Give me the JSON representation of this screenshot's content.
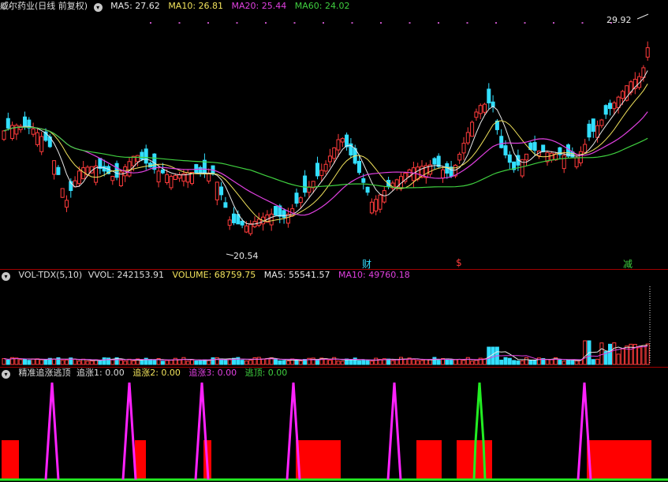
{
  "colors": {
    "up": "#ff3b3b",
    "down": "#33dfff",
    "ma5": "#e8e8e8",
    "ma10": "#f2e35c",
    "ma20": "#e040e0",
    "ma60": "#3fcf3f",
    "volume": "#e8e8e8",
    "signal_main": "#ff22ff",
    "signal_green": "#22ee22",
    "signal_block": "#ff0000"
  },
  "main_panel": {
    "stock_name": "威尔药业(日线 前复权)",
    "collapse_icon": "chevron-down-icon",
    "ma5": "MA5: 27.62",
    "ma10": "MA10: 26.81",
    "ma20": "MA20: 25.44",
    "ma60": "MA60: 24.02",
    "high_label": "29.92",
    "low_label": "20.54",
    "events": [
      {
        "text": "财",
        "color": "#33dfff"
      },
      {
        "text": "$",
        "color": "#ff3b3b"
      },
      {
        "text": "减",
        "color": "#3fcf3f"
      }
    ]
  },
  "volume_panel": {
    "indicator": "VOL-TDX(5,10)",
    "vvol": "VVOL: 242153.91",
    "volume": "VOLUME: 68759.75",
    "ma5": "MA5: 55541.57",
    "ma10": "MA10: 49760.18"
  },
  "signal_panel": {
    "indicator": "精准追涨逃顶",
    "zz1": "追涨1: 0.00",
    "zz2": "追涨2: 0.00",
    "zz3": "追涨3: 0.00",
    "td": "逃顶: 0.00"
  }
}
